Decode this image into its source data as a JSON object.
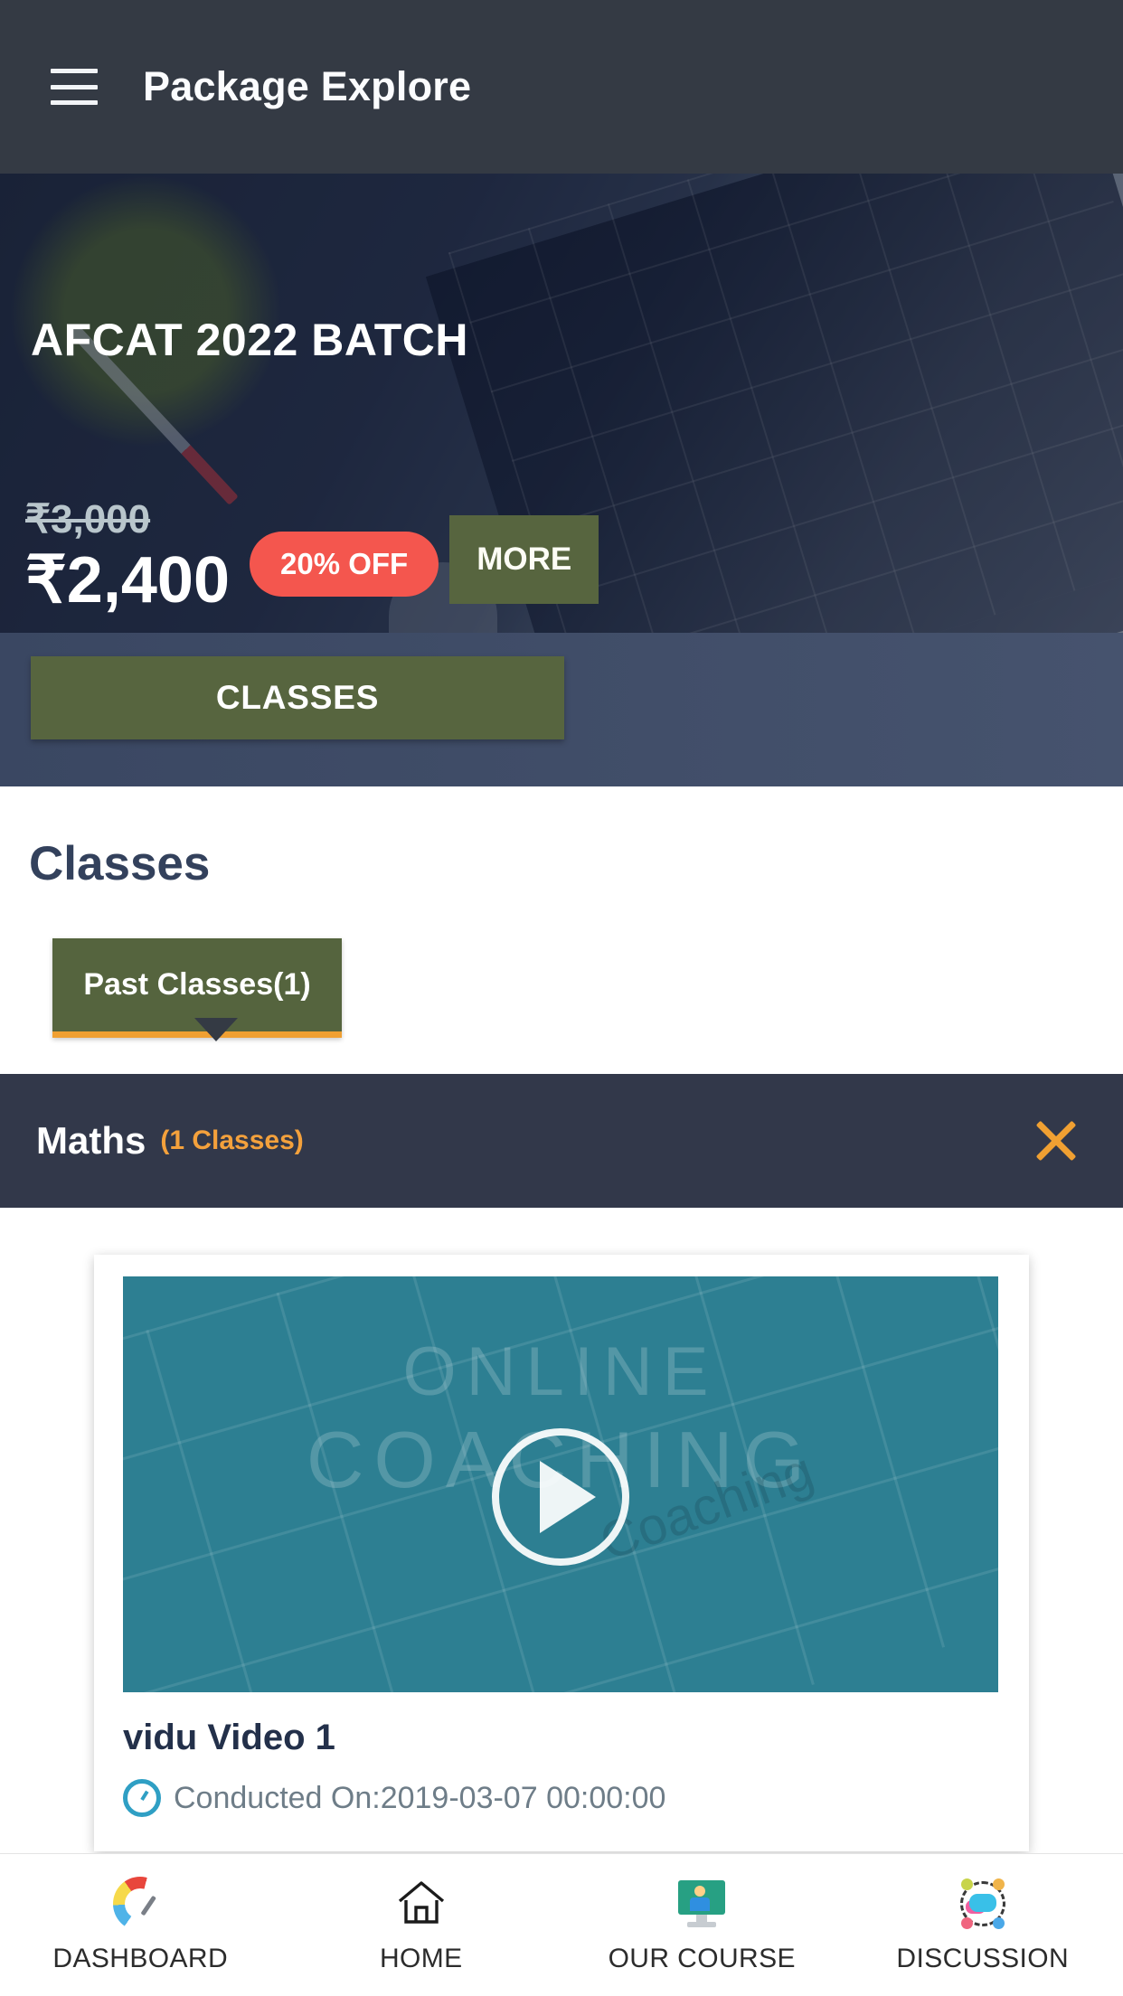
{
  "appbar": {
    "menu_icon": "hamburger-menu-icon",
    "title": "Package Explore"
  },
  "hero": {
    "batch_title": "AFCAT 2022 BATCH",
    "price_old": "₹3,000",
    "price_new": "₹2,400",
    "discount_badge": "20% OFF",
    "more_label": "MORE",
    "classes_label": "CLASSES"
  },
  "classes_section": {
    "heading": "Classes",
    "tab_label": "Past Classes(1)"
  },
  "subject": {
    "name": "Maths",
    "count_label": "(1 Classes)",
    "close_icon": "close-x-icon"
  },
  "video": {
    "thumb_watermark_line1": "ONLINE",
    "thumb_watermark_line2": "COACHING",
    "thumb_watermark_sub": "Coaching",
    "play_icon": "play-icon",
    "title": "vidu Video 1",
    "clock_icon": "clock-icon",
    "conducted_on": "Conducted On:2019-03-07 00:00:00"
  },
  "bottom_nav": [
    {
      "icon": "dashboard-gauge-icon",
      "label": "DASHBOARD"
    },
    {
      "icon": "home-icon",
      "label": "HOME"
    },
    {
      "icon": "our-course-monitor-icon",
      "label": "OUR COURSE"
    },
    {
      "icon": "discussion-people-icon",
      "label": "DISCUSSION"
    }
  ],
  "colors": {
    "appbar_bg": "#343a44",
    "olive": "#57653f",
    "discount_red": "#f4564e",
    "accent_orange": "#f0a032",
    "subject_bar_bg": "#32384a",
    "thumb_teal": "#2d7f92",
    "strip_slate": "#46536e",
    "heading_navy": "#33415c"
  }
}
